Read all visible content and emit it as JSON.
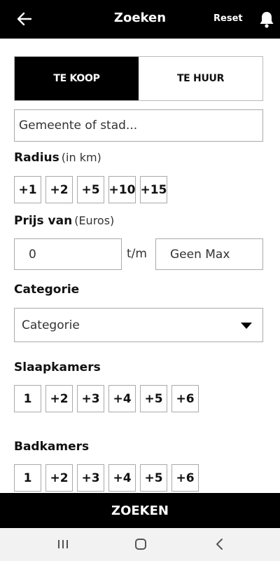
{
  "header": {
    "title": "Zoeken",
    "reset_label": "Reset",
    "back_icon": "arrow-left-icon",
    "bell_icon": "bell-icon"
  },
  "listing_type": {
    "options": [
      "TE KOOP",
      "TE HUUR"
    ],
    "selected": "TE KOOP"
  },
  "location": {
    "placeholder": "Gemeente of stad..."
  },
  "radius": {
    "label": "Radius",
    "unit": "(in km)",
    "options": [
      "+1",
      "+2",
      "+5",
      "+10",
      "+15"
    ]
  },
  "price": {
    "label": "Prijs van",
    "unit": "(Euros)",
    "min_value": "0",
    "separator": "t/m",
    "max_value": "Geen Max"
  },
  "category": {
    "label": "Categorie",
    "selected": "Categorie"
  },
  "bedrooms": {
    "label": "Slaapkamers",
    "options": [
      "1",
      "+2",
      "+3",
      "+4",
      "+5",
      "+6"
    ]
  },
  "bathrooms": {
    "label": "Badkamers",
    "options": [
      "1",
      "+2",
      "+3",
      "+4",
      "+5",
      "+6"
    ]
  },
  "search_button": {
    "label": "ZOEKEN"
  },
  "colors": {
    "primary": "#000000",
    "background": "#ffffff",
    "border": "#aaaaaa",
    "nav_bar": "#f2f2f2"
  }
}
